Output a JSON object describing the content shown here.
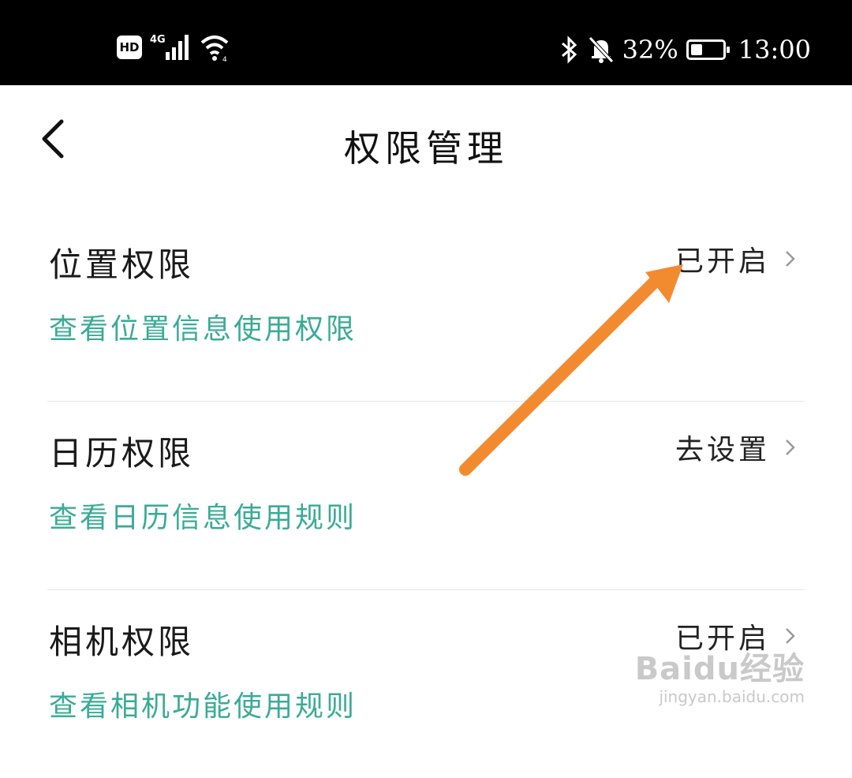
{
  "status_bar": {
    "network_badge": "HD",
    "network_type": "4G",
    "battery_percent": "32%",
    "time": "13:00",
    "battery_level": 0.32,
    "icons": [
      "hd-icon",
      "signal-icon",
      "wifi-icon",
      "bluetooth-icon",
      "mute-bell-icon",
      "battery-icon"
    ]
  },
  "header": {
    "title": "权限管理",
    "back_icon": "chevron-left-icon"
  },
  "permissions": [
    {
      "name": "位置权限",
      "desc": "查看位置信息使用权限",
      "status": "已开启"
    },
    {
      "name": "日历权限",
      "desc": "查看日历信息使用规则",
      "status": "去设置"
    },
    {
      "name": "相机权限",
      "desc": "查看相机功能使用规则",
      "status": "已开启"
    }
  ],
  "colors": {
    "status_bar_bg": "#000000",
    "link_green": "#3aab96",
    "annotation_orange": "#f28b30",
    "divider": "#e6e6e6"
  },
  "watermark": {
    "logo": "Baidu经验",
    "url": "jingyan.baidu.com"
  }
}
